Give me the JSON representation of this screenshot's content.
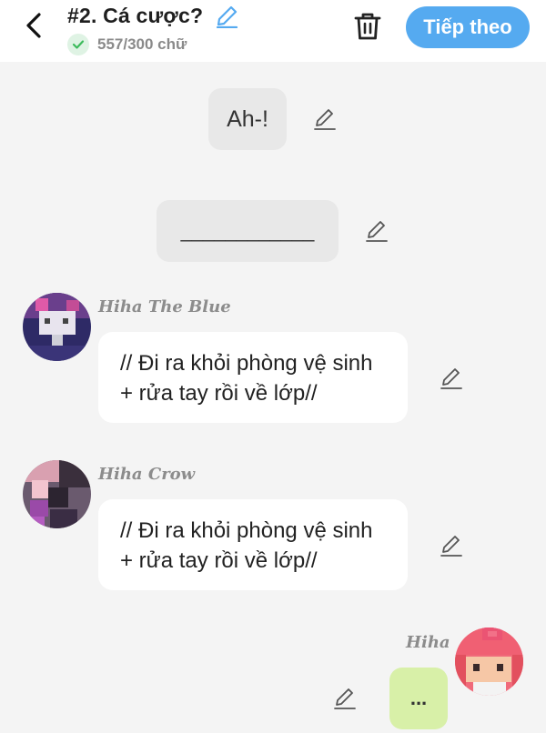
{
  "header": {
    "title": "#2. Cá cược?",
    "word_count": "557/300 chữ",
    "next_label": "Tiếp theo"
  },
  "messages": {
    "narration_1": "Ah-!",
    "narration_2": "____________",
    "chat_1": {
      "name": "Hiha The Blue",
      "text": "// Đi ra khỏi phòng vệ sinh + rửa tay rồi về lớp//"
    },
    "chat_2": {
      "name": "Hiha Crow",
      "text": "// Đi ra khỏi phòng vệ sinh + rửa tay rồi về lớp//"
    },
    "my_name": "Hiha",
    "my_text": "..."
  },
  "colors": {
    "accent": "#55aaf0",
    "my_bubble": "#d8f0a8",
    "check": "#3dbb5c"
  }
}
